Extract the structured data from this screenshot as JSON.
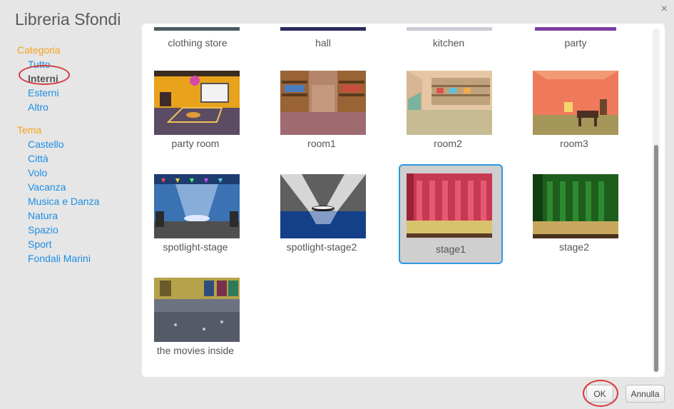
{
  "dialog": {
    "title": "Libreria Sfondi",
    "close_glyph": "×"
  },
  "sidebar": {
    "category_title": "Categoria",
    "category_items": [
      {
        "label": "Tutto",
        "selected": false
      },
      {
        "label": "Interni",
        "selected": true
      },
      {
        "label": "Esterni",
        "selected": false
      },
      {
        "label": "Altro",
        "selected": false
      }
    ],
    "theme_title": "Tema",
    "theme_items": [
      {
        "label": "Castello"
      },
      {
        "label": "Città"
      },
      {
        "label": "Volo"
      },
      {
        "label": "Vacanza"
      },
      {
        "label": "Musica e Danza"
      },
      {
        "label": "Natura"
      },
      {
        "label": "Spazio"
      },
      {
        "label": "Sport"
      },
      {
        "label": "Fondali Marini"
      }
    ]
  },
  "library": {
    "partial_row": [
      {
        "label": "clothing store"
      },
      {
        "label": "hall"
      },
      {
        "label": "kitchen"
      },
      {
        "label": "party"
      }
    ],
    "items": [
      {
        "label": "party room"
      },
      {
        "label": "room1"
      },
      {
        "label": "room2"
      },
      {
        "label": "room3"
      },
      {
        "label": "spotlight-stage"
      },
      {
        "label": "spotlight-stage2"
      },
      {
        "label": "stage1",
        "selected": true
      },
      {
        "label": "stage2"
      },
      {
        "label": "the movies inside"
      }
    ]
  },
  "buttons": {
    "ok": "OK",
    "cancel": "Annulla"
  },
  "colors": {
    "accent": "#2b9ae0",
    "category_title": "#f4a31c",
    "link": "#1d8ee3",
    "annotation": "#d63a3a"
  }
}
